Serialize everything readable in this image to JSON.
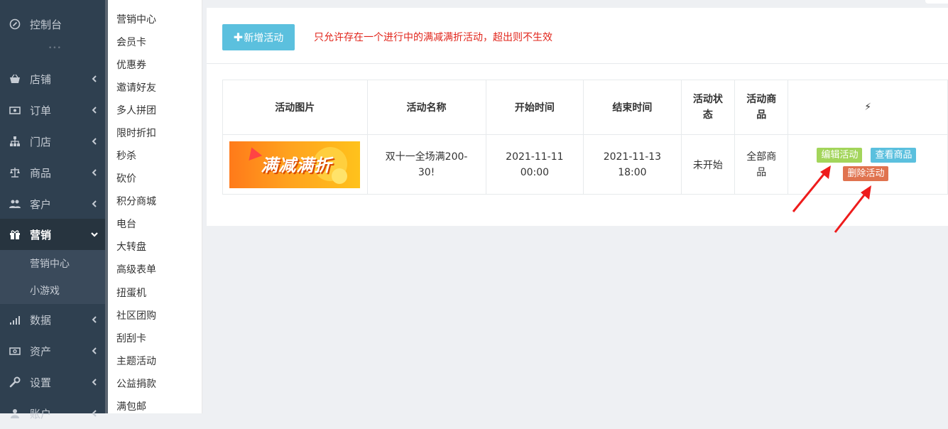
{
  "sidebar": {
    "items": [
      {
        "label": "控制台",
        "icon": "dashboard-icon"
      },
      {
        "label": "店铺",
        "icon": "basket-icon"
      },
      {
        "label": "订单",
        "icon": "money-icon"
      },
      {
        "label": "门店",
        "icon": "sitemap-icon"
      },
      {
        "label": "商品",
        "icon": "balance-icon"
      },
      {
        "label": "客户",
        "icon": "users-icon"
      },
      {
        "label": "营销",
        "icon": "gift-icon"
      },
      {
        "label": "数据",
        "icon": "signal-icon"
      },
      {
        "label": "资产",
        "icon": "cash-icon"
      },
      {
        "label": "设置",
        "icon": "wrench-icon"
      },
      {
        "label": "账户",
        "icon": "user-icon"
      }
    ],
    "sub_items": [
      "营销中心",
      "小游戏"
    ]
  },
  "submenu": {
    "items": [
      "营销中心",
      "会员卡",
      "优惠券",
      "邀请好友",
      "多人拼团",
      "限时折扣",
      "秒杀",
      "砍价",
      "积分商城",
      "电台",
      "大转盘",
      "高级表单",
      "扭蛋机",
      "社区团购",
      "刮刮卡",
      "主题活动",
      "公益捐款",
      "满包邮"
    ]
  },
  "toolbar": {
    "add_label": "新增活动",
    "add_icon": "plus-icon",
    "notice": "只允许存在一个进行中的满减满折活动，超出则不生效"
  },
  "table": {
    "headers": [
      "活动图片",
      "活动名称",
      "开始时间",
      "结束时间",
      "活动状态",
      "活动商品",
      "⚡"
    ],
    "rows": [
      {
        "banner_text": "满减满折",
        "name": "双十一全场满200-30!",
        "start_date": "2021-11-11",
        "start_time": "00:00",
        "end_date": "2021-11-13",
        "end_time": "18:00",
        "status": "未开始",
        "goods": "全部商品",
        "actions": {
          "edit": "编辑活动",
          "view": "查看商品",
          "delete": "删除活动"
        }
      }
    ]
  },
  "colors": {
    "sidebar_bg": "#2f4050",
    "info": "#5bc0de",
    "success": "#a3d55b",
    "danger": "#e0734f",
    "notice": "#e1251b",
    "annotation_arrow": "#ee1c1c"
  }
}
